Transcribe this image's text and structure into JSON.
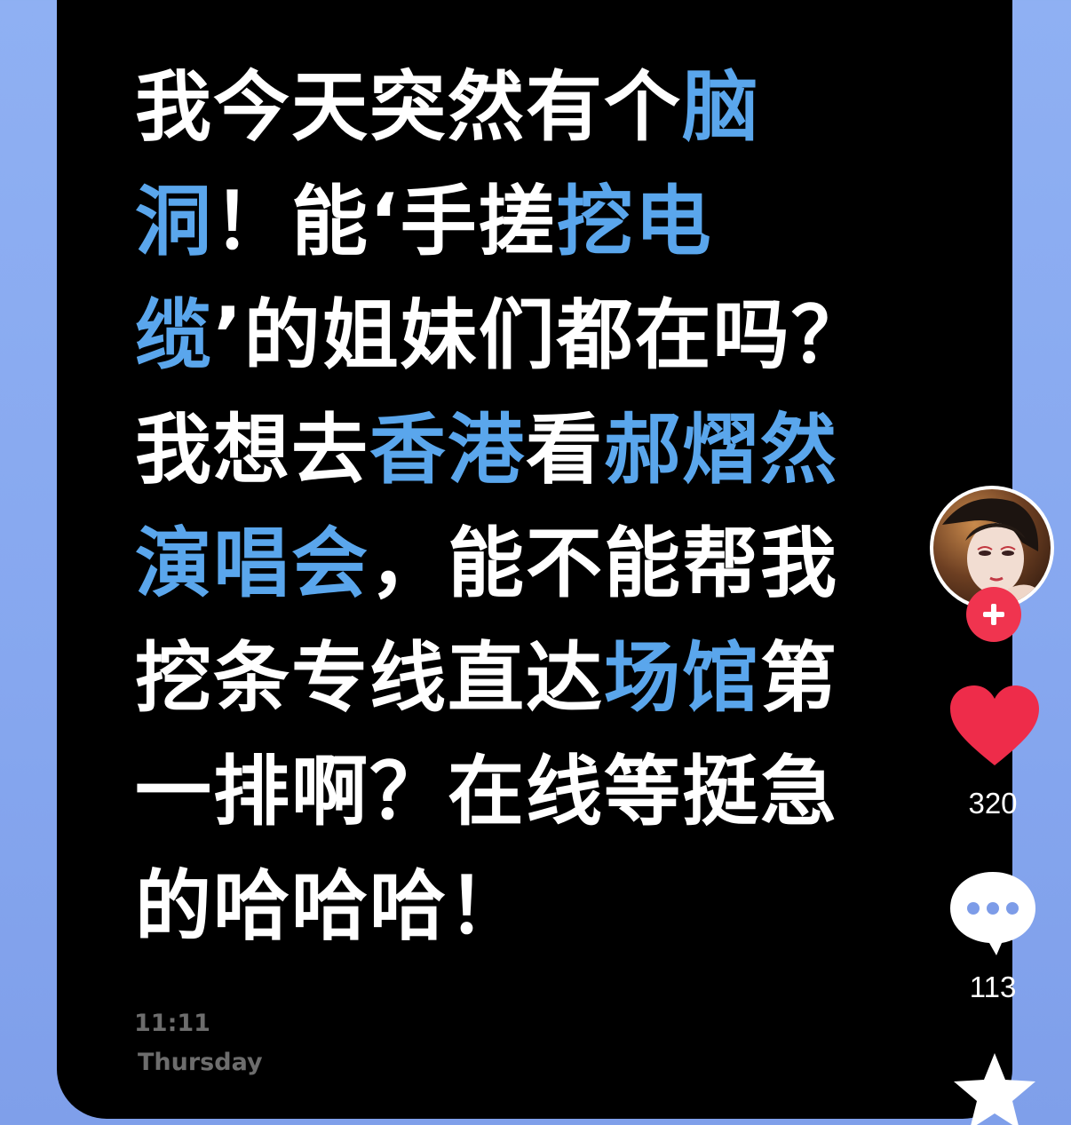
{
  "note": {
    "segments": [
      {
        "text": "我今天突然有个",
        "highlight": false
      },
      {
        "text": "脑洞",
        "highlight": true
      },
      {
        "text": "！能‘手搓",
        "highlight": false
      },
      {
        "text": "挖电缆",
        "highlight": true
      },
      {
        "text": "’的姐妹们都在吗？我想去",
        "highlight": false
      },
      {
        "text": "香港",
        "highlight": true
      },
      {
        "text": "看",
        "highlight": false
      },
      {
        "text": "郝熠然演唱会",
        "highlight": true
      },
      {
        "text": "，能不能帮我挖条专线直达",
        "highlight": false
      },
      {
        "text": "场馆",
        "highlight": true
      },
      {
        "text": "第一排啊？在线等挺急的哈哈哈！",
        "highlight": false
      }
    ]
  },
  "status": {
    "time": "11:11",
    "day": "Thursday"
  },
  "actions": {
    "like_count": "320",
    "comment_count": "113",
    "follow_icon": "plus-icon",
    "like_icon": "heart-icon",
    "comment_icon": "speech-bubble-icon",
    "favorite_icon": "star-icon"
  },
  "colors": {
    "highlight": "#5aa6ec",
    "text": "#ffffff",
    "card_bg": "#000000",
    "page_bg": "#8fb0f3",
    "like": "#ee2c4a",
    "follow": "#f0344f"
  }
}
